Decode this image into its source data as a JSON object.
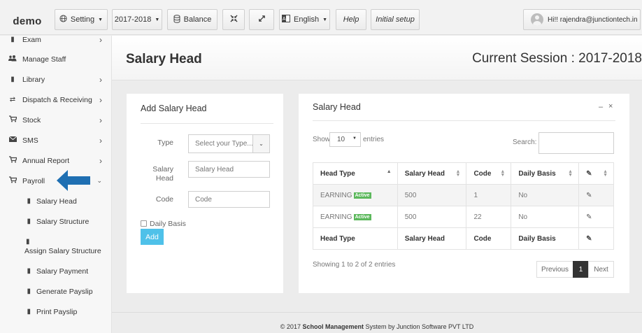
{
  "brand": "demo",
  "topbar": {
    "setting_label": "Setting",
    "session_label": "2017-2018",
    "balance_label": "Balance",
    "language_label": "English",
    "help_label": "Help",
    "initial_setup_label": "Initial setup",
    "user_greeting": "Hi!! rajendra@junctiontech.in"
  },
  "sidebar": {
    "items": [
      {
        "label": "Exam",
        "icon": "book-icon"
      },
      {
        "label": "Manage Staff",
        "icon": "users-icon"
      },
      {
        "label": "Library",
        "icon": "book-icon"
      },
      {
        "label": "Dispatch & Receiving",
        "icon": "exchange-icon"
      },
      {
        "label": "Stock",
        "icon": "cart-icon"
      },
      {
        "label": "SMS",
        "icon": "envelope-icon"
      },
      {
        "label": "Annual Report",
        "icon": "cart-icon"
      },
      {
        "label": "Payroll",
        "icon": "cart-icon"
      }
    ],
    "payroll_sub": [
      {
        "label": "Salary Head"
      },
      {
        "label": "Salary Structure"
      },
      {
        "label": "Assign Salary Structure"
      },
      {
        "label": "Salary Payment"
      },
      {
        "label": "Generate Payslip"
      },
      {
        "label": "Print Payslip"
      }
    ]
  },
  "page": {
    "title": "Salary Head",
    "session_text": "Current Session : 2017-2018"
  },
  "form": {
    "title": "Add Salary Head",
    "type_label": "Type",
    "type_placeholder": "Select your Type...",
    "salary_head_label_1": "Salary",
    "salary_head_label_2": "Head",
    "salary_head_placeholder": "Salary Head",
    "code_label": "Code",
    "code_placeholder": "Code",
    "daily_basis_label": "Daily Basis",
    "add_label": "Add"
  },
  "list": {
    "title": "Salary Head",
    "show_label": "Show",
    "entries_value": "10",
    "entries_label": "entries",
    "search_label": "Search:",
    "columns": [
      "Head Type",
      "Salary Head",
      "Code",
      "Daily Basis"
    ],
    "rows": [
      {
        "head_type": "EARNING",
        "badge": "Active",
        "salary_head": "500",
        "code": "1",
        "daily_basis": "No"
      },
      {
        "head_type": "EARNING",
        "badge": "Active",
        "salary_head": "500",
        "code": "22",
        "daily_basis": "No"
      }
    ],
    "info": "Showing 1 to 2 of 2 entries",
    "pagination": {
      "previous": "Previous",
      "current": "1",
      "next": "Next"
    }
  },
  "footer": {
    "prefix": "© 2017 ",
    "bold": "School Management",
    "suffix": " System by Junction Software PVT LTD"
  }
}
